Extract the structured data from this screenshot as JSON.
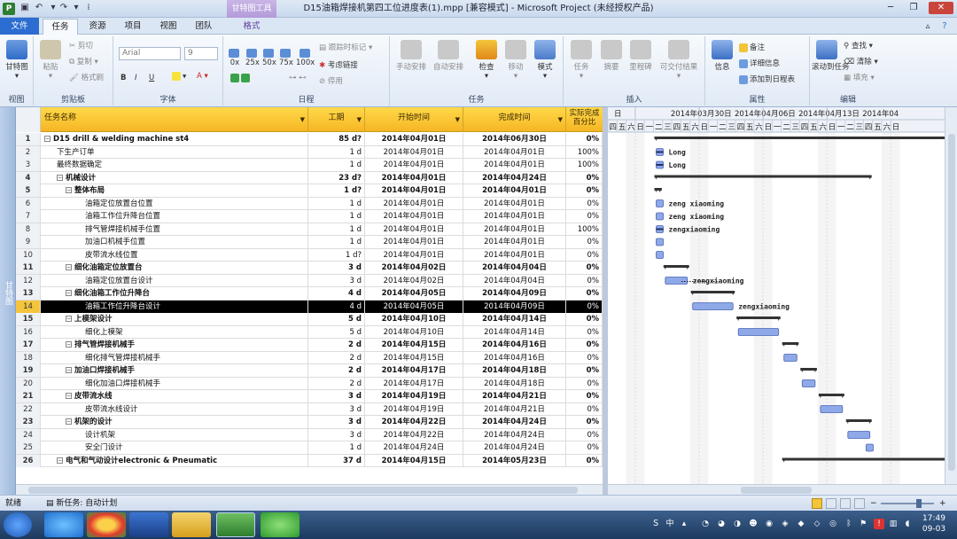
{
  "window": {
    "title": "D15油箱焊接机第四工位进度表(1).mpp [兼容模式] - Microsoft Project (未经授权产品)",
    "context_tab_group": "甘特图工具"
  },
  "tabs": [
    {
      "label": "文件"
    },
    {
      "label": "任务"
    },
    {
      "label": "资源"
    },
    {
      "label": "项目"
    },
    {
      "label": "视图"
    },
    {
      "label": "团队"
    },
    {
      "label": "格式"
    }
  ],
  "ribbon": {
    "view_group": {
      "label": "视图",
      "gantt_button": "甘特图"
    },
    "clipboard": {
      "label": "剪贴板",
      "paste": "粘贴",
      "cut": "剪切",
      "copy": "复制",
      "format_painter": "格式刷"
    },
    "font": {
      "label": "字体",
      "font_name": "Arial",
      "font_size": "9"
    },
    "schedule": {
      "label": "日程",
      "pcts": [
        "0x",
        "25x",
        "50x",
        "75x",
        "100x"
      ],
      "mark_on_track": "跟踪时标记",
      "respect_links": "考虑链接",
      "inactivate": "停用"
    },
    "tasks": {
      "label": "任务",
      "manual": "手动安排",
      "auto": "自动安排",
      "inspect": "检查",
      "move": "移动",
      "mode": "模式"
    },
    "insert": {
      "label": "插入",
      "task": "任务",
      "summary": "摘要",
      "milestone": "里程碑",
      "deliverable": "可交付结果"
    },
    "properties": {
      "label": "属性",
      "info": "信息",
      "notes": "备注",
      "details": "详细信息",
      "add_timeline": "添加到日程表"
    },
    "editing": {
      "label": "编辑",
      "scroll_to_task": "滚动到任务",
      "find": "查找",
      "clear": "清除",
      "fill": "填充"
    }
  },
  "sidebar_label": "甘特图",
  "table": {
    "headers": [
      "任务名称",
      "工期",
      "开始时间",
      "完成时间",
      "实际完成百分比"
    ],
    "rows": [
      {
        "id": "1",
        "name": "D15 drill & welding machine st4",
        "dur": "85 d?",
        "start": "2014年04月01日",
        "finish": "2014年06月30日",
        "pct": "0%",
        "level": 0,
        "summary": true
      },
      {
        "id": "2",
        "name": "下生产订单",
        "dur": "1 d",
        "start": "2014年04月01日",
        "finish": "2014年04月01日",
        "pct": "100%",
        "level": 1,
        "summary": false
      },
      {
        "id": "3",
        "name": "最终数据确定",
        "dur": "1 d",
        "start": "2014年04月01日",
        "finish": "2014年04月01日",
        "pct": "100%",
        "level": 1,
        "summary": false
      },
      {
        "id": "4",
        "name": "机械设计",
        "dur": "23 d?",
        "start": "2014年04月01日",
        "finish": "2014年04月24日",
        "pct": "0%",
        "level": 1,
        "summary": true
      },
      {
        "id": "5",
        "name": "整体布局",
        "dur": "1 d?",
        "start": "2014年04月01日",
        "finish": "2014年04月01日",
        "pct": "0%",
        "level": 2,
        "summary": true
      },
      {
        "id": "6",
        "name": "油箱定位放置台位置",
        "dur": "1 d",
        "start": "2014年04月01日",
        "finish": "2014年04月01日",
        "pct": "0%",
        "level": 3,
        "summary": false
      },
      {
        "id": "7",
        "name": "油箱工作位升降台位置",
        "dur": "1 d",
        "start": "2014年04月01日",
        "finish": "2014年04月01日",
        "pct": "0%",
        "level": 3,
        "summary": false
      },
      {
        "id": "8",
        "name": "排气管焊接机械手位置",
        "dur": "1 d",
        "start": "2014年04月01日",
        "finish": "2014年04月01日",
        "pct": "100%",
        "level": 3,
        "summary": false
      },
      {
        "id": "9",
        "name": "加油口机械手位置",
        "dur": "1 d",
        "start": "2014年04月01日",
        "finish": "2014年04月01日",
        "pct": "0%",
        "level": 3,
        "summary": false
      },
      {
        "id": "10",
        "name": "皮带流水线位置",
        "dur": "1 d?",
        "start": "2014年04月01日",
        "finish": "2014年04月01日",
        "pct": "0%",
        "level": 3,
        "summary": false
      },
      {
        "id": "11",
        "name": "细化油箱定位放置台",
        "dur": "3 d",
        "start": "2014年04月02日",
        "finish": "2014年04月04日",
        "pct": "0%",
        "level": 2,
        "summary": true
      },
      {
        "id": "12",
        "name": "油箱定位放置台设计",
        "dur": "3 d",
        "start": "2014年04月02日",
        "finish": "2014年04月04日",
        "pct": "0%",
        "level": 3,
        "summary": false
      },
      {
        "id": "13",
        "name": "细化油箱工作位升降台",
        "dur": "4 d",
        "start": "2014年04月05日",
        "finish": "2014年04月09日",
        "pct": "0%",
        "level": 2,
        "summary": true
      },
      {
        "id": "14",
        "name": "油箱工作位升降台设计",
        "dur": "4 d",
        "start": "2014年04月05日",
        "finish": "2014年04月09日",
        "pct": "0%",
        "level": 3,
        "summary": false,
        "selected": true
      },
      {
        "id": "15",
        "name": "上模架设计",
        "dur": "5 d",
        "start": "2014年04月10日",
        "finish": "2014年04月14日",
        "pct": "0%",
        "level": 2,
        "summary": true
      },
      {
        "id": "16",
        "name": "细化上模架",
        "dur": "5 d",
        "start": "2014年04月10日",
        "finish": "2014年04月14日",
        "pct": "0%",
        "level": 3,
        "summary": false
      },
      {
        "id": "17",
        "name": "排气管焊接机械手",
        "dur": "2 d",
        "start": "2014年04月15日",
        "finish": "2014年04月16日",
        "pct": "0%",
        "level": 2,
        "summary": true
      },
      {
        "id": "18",
        "name": "细化排气管焊接机械手",
        "dur": "2 d",
        "start": "2014年04月15日",
        "finish": "2014年04月16日",
        "pct": "0%",
        "level": 3,
        "summary": false
      },
      {
        "id": "19",
        "name": "加油口焊接机械手",
        "dur": "2 d",
        "start": "2014年04月17日",
        "finish": "2014年04月18日",
        "pct": "0%",
        "level": 2,
        "summary": true
      },
      {
        "id": "20",
        "name": "细化加油口焊接机械手",
        "dur": "2 d",
        "start": "2014年04月17日",
        "finish": "2014年04月18日",
        "pct": "0%",
        "level": 3,
        "summary": false
      },
      {
        "id": "21",
        "name": "皮带流水线",
        "dur": "3 d",
        "start": "2014年04月19日",
        "finish": "2014年04月21日",
        "pct": "0%",
        "level": 2,
        "summary": true
      },
      {
        "id": "22",
        "name": "皮带流水线设计",
        "dur": "3 d",
        "start": "2014年04月19日",
        "finish": "2014年04月21日",
        "pct": "0%",
        "level": 3,
        "summary": false
      },
      {
        "id": "23",
        "name": "机架的设计",
        "dur": "3 d",
        "start": "2014年04月22日",
        "finish": "2014年04月24日",
        "pct": "0%",
        "level": 2,
        "summary": true
      },
      {
        "id": "24",
        "name": "设计机架",
        "dur": "3 d",
        "start": "2014年04月22日",
        "finish": "2014年04月24日",
        "pct": "0%",
        "level": 3,
        "summary": false
      },
      {
        "id": "25",
        "name": "安全门设计",
        "dur": "1 d",
        "start": "2014年04月24日",
        "finish": "2014年04月24日",
        "pct": "0%",
        "level": 3,
        "summary": false
      },
      {
        "id": "26",
        "name": "电气和气动设计electronic & Pneumatic",
        "dur": "37 d",
        "start": "2014年04月15日",
        "finish": "2014年05月23日",
        "pct": "0%",
        "level": 1,
        "summary": true
      }
    ]
  },
  "gantt": {
    "weeks": [
      "日",
      "2014年03月30日",
      "2014年04月06日",
      "2014年04月13日",
      "2014年04"
    ],
    "days": [
      "四",
      "五",
      "六",
      "日",
      "一",
      "二",
      "三",
      "四",
      "五",
      "六",
      "日",
      "一",
      "二",
      "三",
      "四",
      "五",
      "六",
      "日",
      "一",
      "二",
      "三",
      "四",
      "五",
      "六",
      "日",
      "一",
      "二",
      "三",
      "四",
      "五",
      "六",
      "日"
    ],
    "labels": {
      "r2": "Long",
      "r3": "Long",
      "r6": "zeng xiaoming",
      "r7": "zeng xiaoming",
      "r8": "zengxiaoming",
      "r12": "zengxiaoming",
      "r14": "zengxiaoming"
    },
    "bar_color": "#8ea8e8",
    "summary_color": "#333333",
    "weekend_shade": "#f4f4f4"
  },
  "status": {
    "ready": "就绪",
    "new_tasks": "新任务: 自动计划"
  },
  "taskbar": {
    "ime": "中",
    "time": "17:49",
    "date": "09-03"
  }
}
